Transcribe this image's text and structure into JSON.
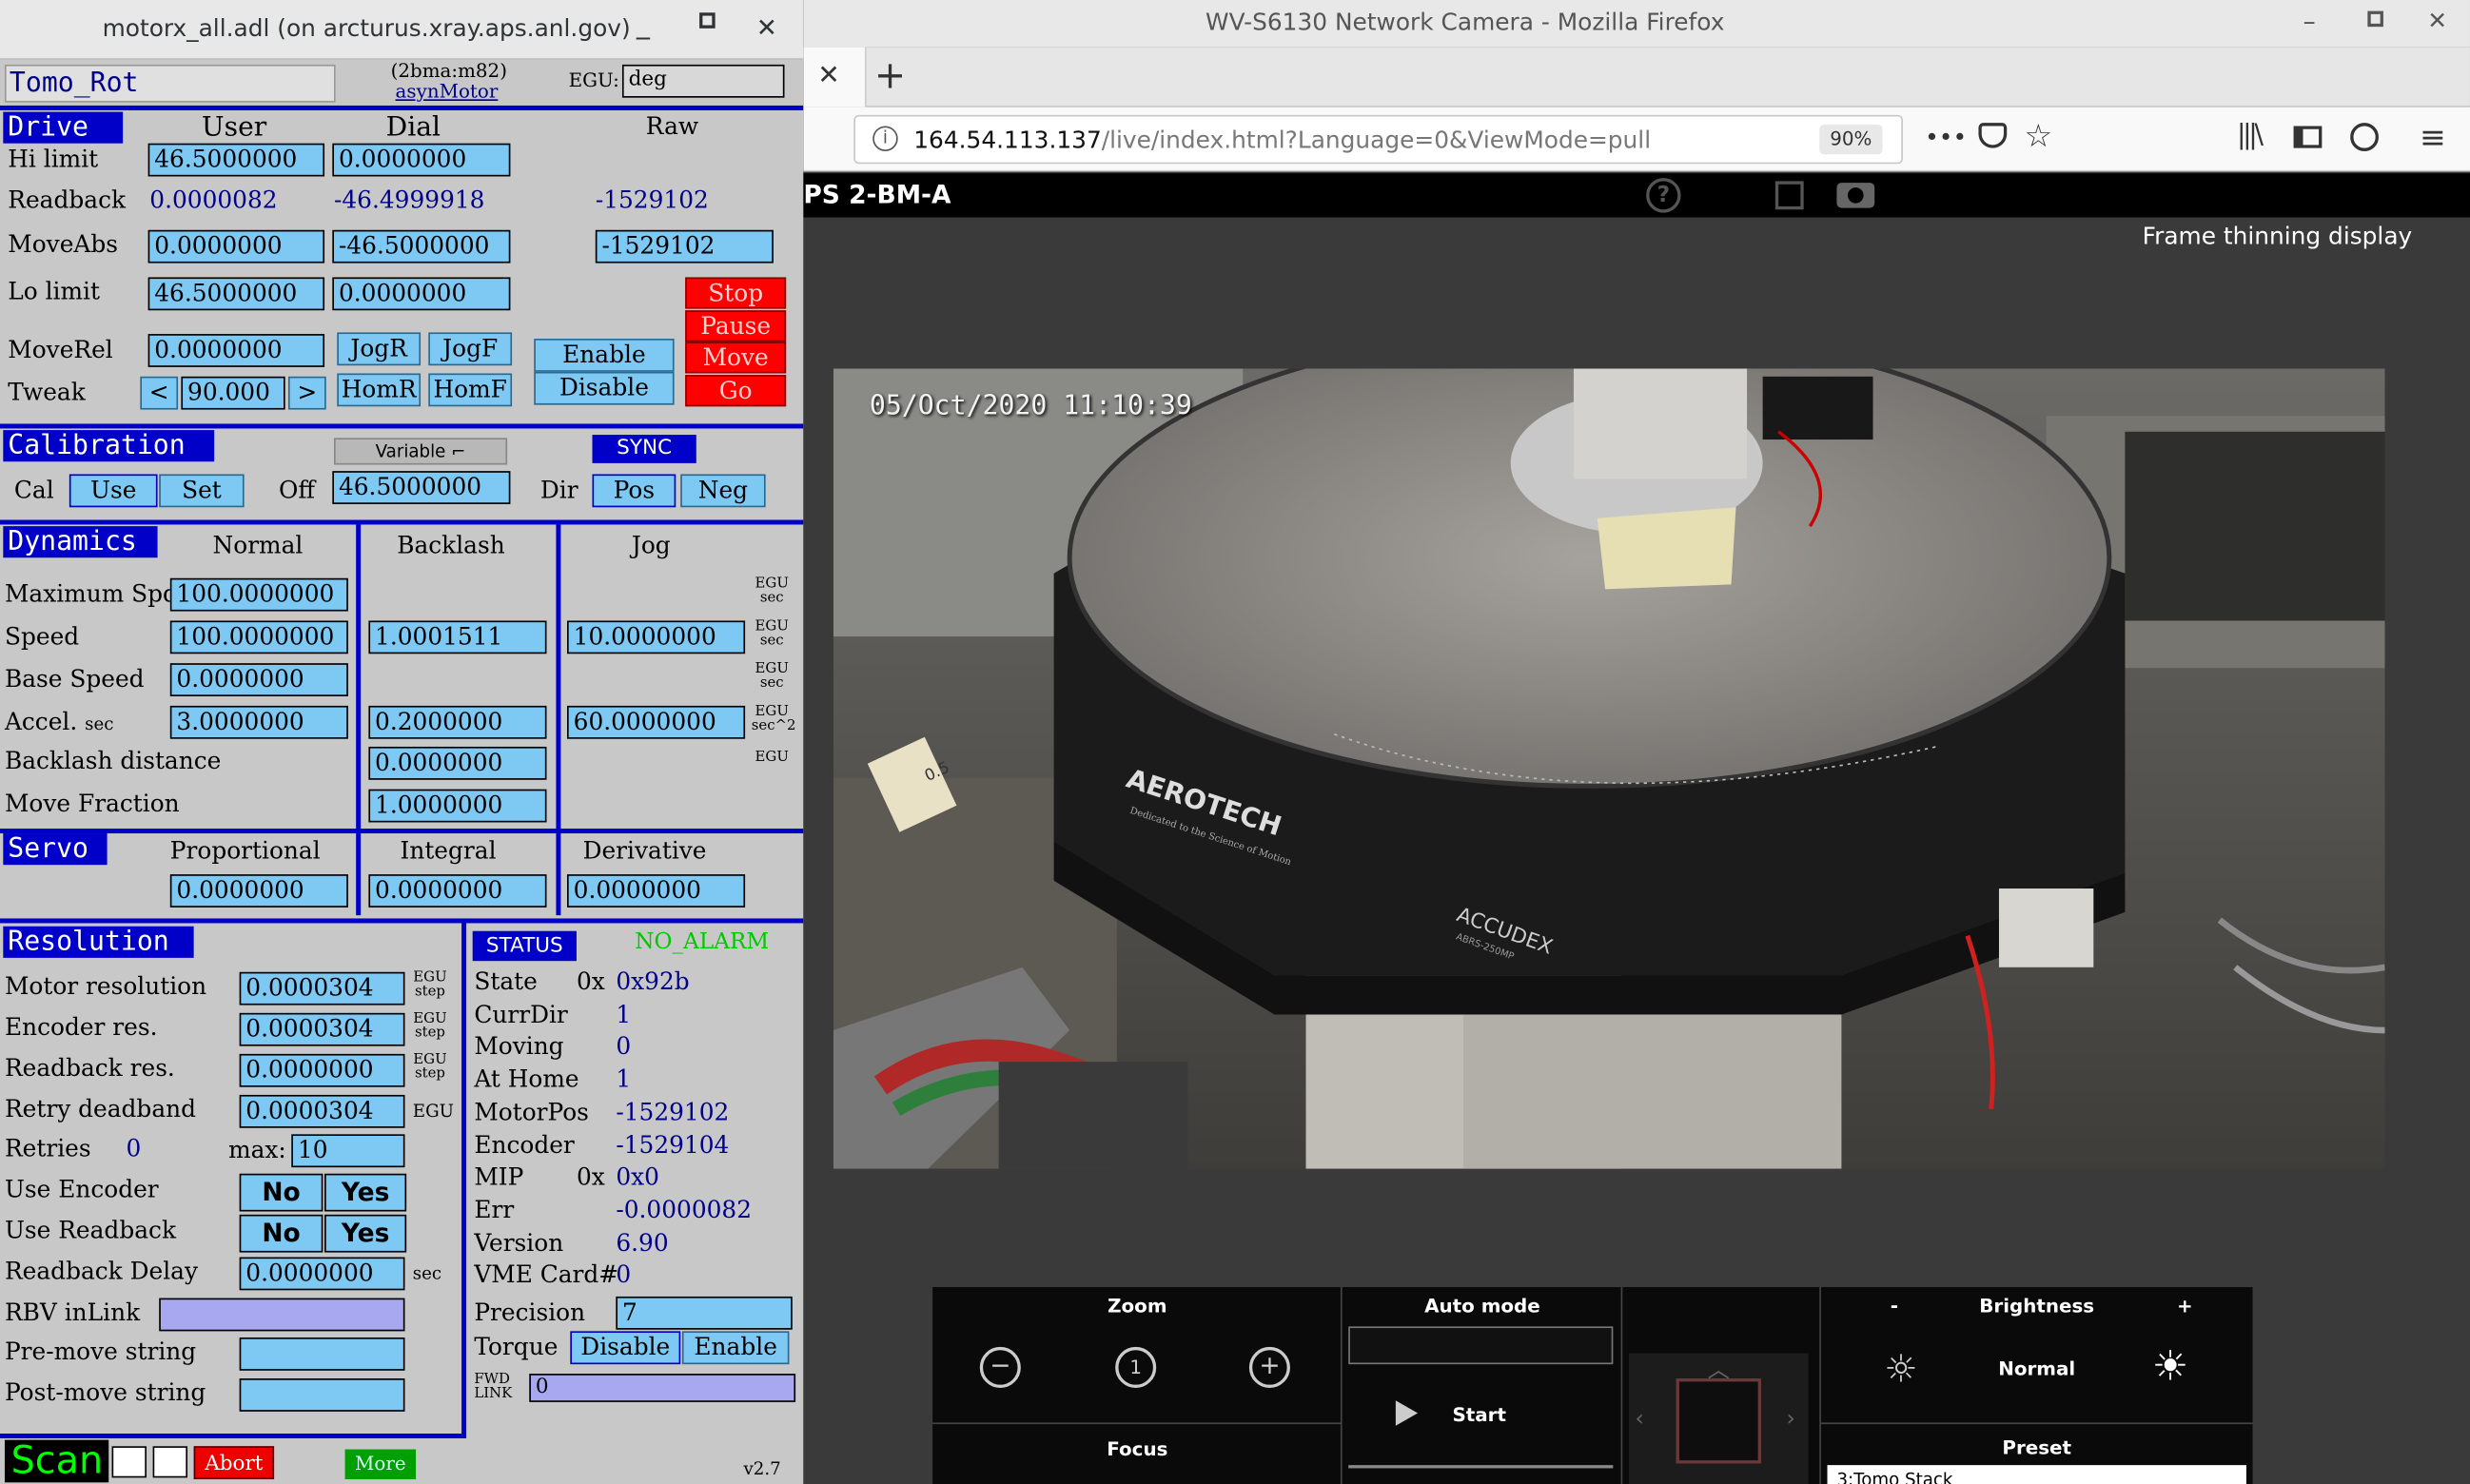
{
  "medm": {
    "title": "motorx_all.adl (on arcturus.xray.aps.anl.gov)",
    "win_controls": [
      "_",
      "□",
      "✕"
    ],
    "motor_name": "Tomo_Rot",
    "pv": "(2bma:m82)",
    "record": "asynMotor",
    "egu_label": "EGU:",
    "egu": "deg",
    "drive": {
      "title": "Drive",
      "user": "User",
      "dial": "Dial",
      "raw": "Raw",
      "hi_limit_label": "Hi limit",
      "hi_user": "46.5000000",
      "hi_dial": "0.0000000",
      "readback_label": "Readback",
      "rb_user": "0.0000082",
      "rb_dial": "-46.4999918",
      "rb_raw": "-1529102",
      "moveabs_label": "MoveAbs",
      "ma_user": "0.0000000",
      "ma_dial": "-46.5000000",
      "ma_raw": "-1529102",
      "lo_limit_label": "Lo limit",
      "lo_user": "46.5000000",
      "lo_dial": "0.0000000",
      "moverel_label": "MoveRel",
      "mr_user": "0.0000000",
      "tweak_label": "Tweak",
      "tweak_val": "90.000",
      "jogr": "JogR",
      "jogf": "JogF",
      "homr": "HomR",
      "homf": "HomF",
      "enable": "Enable",
      "disable": "Disable",
      "stop": "Stop",
      "pause": "Pause",
      "move": "Move",
      "go": "Go",
      "lt": "<",
      "gt": ">"
    },
    "calibration": {
      "title": "Calibration",
      "variable": "Variable",
      "sync": "SYNC",
      "cal": "Cal",
      "use": "Use",
      "set": "Set",
      "off_label": "Off",
      "off": "46.5000000",
      "dir": "Dir",
      "pos": "Pos",
      "neg": "Neg"
    },
    "dynamics": {
      "title": "Dynamics",
      "normal": "Normal",
      "backlash": "Backlash",
      "jog": "Jog",
      "max_spd_label": "Maximum Spd",
      "max_spd": "100.0000000",
      "speed_label": "Speed",
      "speed": "100.0000000",
      "speed_bl": "1.0001511",
      "speed_jog": "10.0000000",
      "base_label": "Base Speed",
      "base": "0.0000000",
      "accel_label": "Accel.",
      "accel_unit": "sec",
      "accel": "3.0000000",
      "accel_bl": "0.2000000",
      "accel_jog": "60.0000000",
      "bl_dist_label": "Backlash distance",
      "bl_dist": "0.0000000",
      "move_frac_label": "Move Fraction",
      "move_frac": "1.0000000",
      "egu_sec": "EGU",
      "sec": "sec",
      "sec2": "sec^2"
    },
    "servo": {
      "title": "Servo",
      "prop": "Proportional",
      "integ": "Integral",
      "deriv": "Derivative",
      "p": "0.0000000",
      "i": "0.0000000",
      "d": "0.0000000"
    },
    "resolution": {
      "title": "Resolution",
      "mres_label": "Motor resolution",
      "mres": "0.0000304",
      "eres_label": "Encoder res.",
      "eres": "0.0000304",
      "rres_label": "Readback res.",
      "rres": "0.0000000",
      "rdbd_label": "Retry deadband",
      "rdbd": "0.0000304",
      "egu": "EGU",
      "step": "step",
      "retries_label": "Retries",
      "retries": "0",
      "max_label": "max:",
      "max": "10",
      "use_enc_label": "Use Encoder",
      "use_rdbk_label": "Use Readback",
      "no": "No",
      "yes": "Yes",
      "rb_delay_label": "Readback Delay",
      "rb_delay": "0.0000000",
      "rb_delay_unit": "sec",
      "rbv_label": "RBV inLink",
      "rbv": "",
      "pre_label": "Pre-move string",
      "pre": "",
      "post_label": "Post-move string",
      "post": ""
    },
    "status": {
      "title": "STATUS",
      "alarm": "NO_ALARM",
      "state_label": "State",
      "ox": "0x",
      "state": "0x92b",
      "currdir_label": "CurrDir",
      "currdir": "1",
      "moving_label": "Moving",
      "moving": "0",
      "athome_label": "At Home",
      "athome": "1",
      "motorpos_label": "MotorPos",
      "motorpos": "-1529102",
      "encoder_label": "Encoder",
      "encoder": "-1529104",
      "mip_label": "MIP",
      "mip": "0x0",
      "err_label": "Err",
      "err": "-0.0000082",
      "version_label": "Version",
      "version": "6.90",
      "vme_label": "VME Card#",
      "vme": "0",
      "precision_label": "Precision",
      "precision": "7",
      "torque_label": "Torque",
      "t_disable": "Disable",
      "t_enable": "Enable",
      "fwd_link_label": "FWD LINK",
      "fwd_link": "0"
    },
    "footer": {
      "scan": "Scan",
      "abort": "Abort",
      "more": "More",
      "version": "v2.7"
    }
  },
  "firefox": {
    "title": "WV-S6130 Network Camera - Mozilla Firefox",
    "url_host": "164.54.113.137",
    "url_path": "/live/index.html?Language=0&ViewMode=pull",
    "zoom": "90%",
    "more": "•••",
    "site_title": "PS 2-BM-A",
    "frame_thinning": "Frame thinning display",
    "timestamp": "05/Oct/2020  11:10:39",
    "zoom_label": "Zoom",
    "auto_mode_label": "Auto mode",
    "start_label": "Start",
    "focus_label": "Focus",
    "brightness_label": "Brightness",
    "brightness_minus": "-",
    "brightness_plus": "+",
    "brightness_value": "Normal",
    "preset_label": "Preset",
    "preset_value": "3:Tomo Stack",
    "stage_brand": "AEROTECH",
    "stage_tag": "Dedicated to the Science of Motion",
    "stage_model": "ACCUDEX",
    "stage_submodel": "ABRS-250MP",
    "label_printed": "0.5"
  }
}
